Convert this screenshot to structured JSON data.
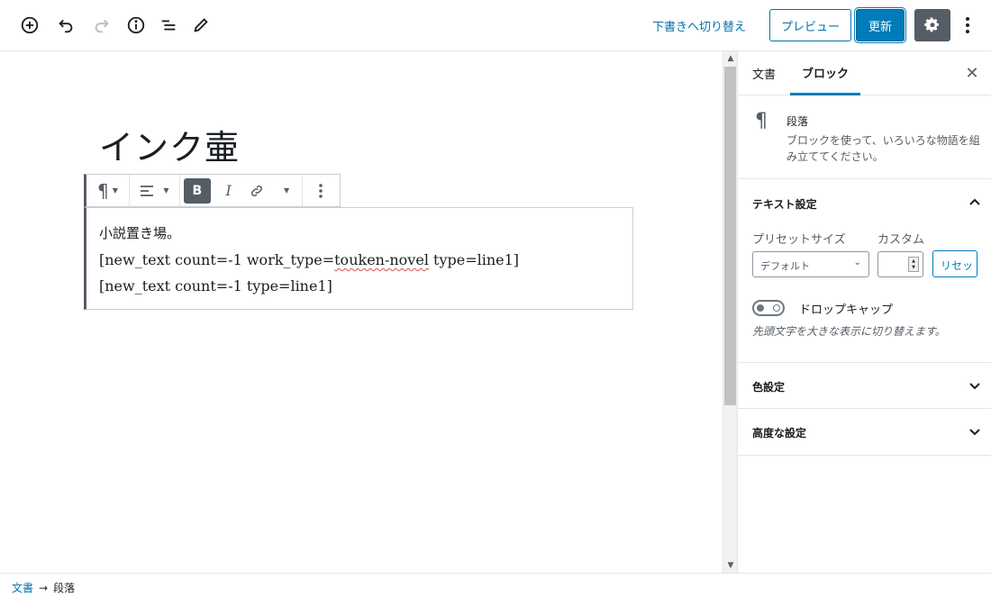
{
  "toolbar": {
    "add_block_icon": "plus-circle-icon",
    "undo_icon": "undo-icon",
    "redo_icon": "redo-icon",
    "info_icon": "info-icon",
    "outline_icon": "list-outline-icon",
    "edit_icon": "pencil-icon",
    "draft_label": "下書きへ切り替え",
    "preview_label": "プレビュー",
    "update_label": "更新",
    "settings_icon": "gear-icon",
    "more_icon": "vertical-ellipsis-icon"
  },
  "editor": {
    "title": "インク壷",
    "lines": [
      "小説置き場。",
      "[new_text count=-1 work_type=",
      "touken-novel",
      " type=line1]",
      "[new_text count=-1 type=line1]"
    ]
  },
  "sidebar": {
    "tabs": [
      "文書",
      "ブロック"
    ],
    "active_tab": "ブロック",
    "close_icon": "close-icon",
    "block": {
      "icon": "¶",
      "name": "段落",
      "description": "ブロックを使って、いろいろな物語を組み立ててください。"
    },
    "text_settings": {
      "title": "テキスト設定",
      "preset_label": "プリセットサイズ",
      "custom_label": "カスタム",
      "preset_value": "デフォルト",
      "reset_label": "リセット",
      "dropcap_label": "ドロップキャップ",
      "dropcap_help": "先頭文字を大きな表示に切り替えます。"
    },
    "color_settings": {
      "title": "色設定"
    },
    "advanced_settings": {
      "title": "高度な設定"
    }
  },
  "footer": {
    "breadcrumb_root": "文書",
    "arrow": "→",
    "breadcrumb_current": "段落"
  },
  "colors": {
    "accent": "#007cba",
    "link": "#0073aa",
    "settings_bg": "#555d66"
  }
}
